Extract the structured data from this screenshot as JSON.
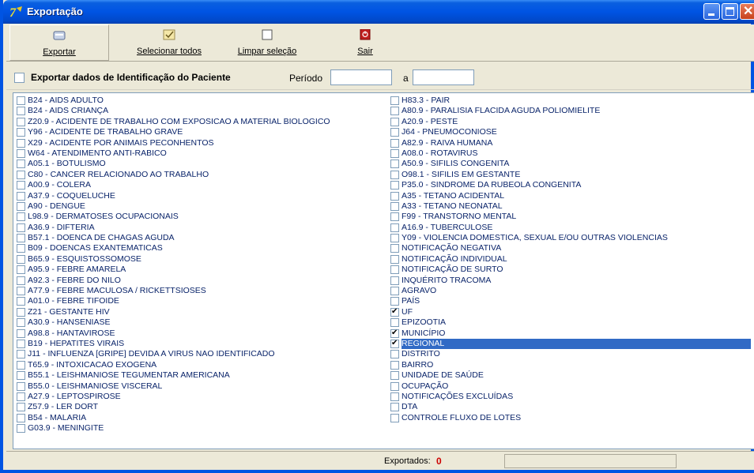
{
  "window": {
    "title": "Exportação"
  },
  "toolbar": {
    "export_label": "Exportar",
    "selectall_label": "Selecionar todos",
    "clear_label": "Limpar seleção",
    "exit_label": "Sair"
  },
  "options": {
    "export_id_label": "Exportar dados de Identificação do Paciente",
    "export_id_checked": false,
    "period_label": "Período",
    "period_from": "",
    "period_sep": "a",
    "period_to": ""
  },
  "list": {
    "left": [
      {
        "label": "B24 - AIDS ADULTO",
        "checked": false
      },
      {
        "label": "B24 - AIDS CRIANÇA",
        "checked": false
      },
      {
        "label": "Z20.9 - ACIDENTE DE TRABALHO COM EXPOSICAO A MATERIAL BIOLOGICO",
        "checked": false
      },
      {
        "label": "Y96 - ACIDENTE DE TRABALHO GRAVE",
        "checked": false
      },
      {
        "label": "X29 - ACIDENTE POR ANIMAIS PECONHENTOS",
        "checked": false
      },
      {
        "label": "W64 - ATENDIMENTO ANTI-RABICO",
        "checked": false
      },
      {
        "label": "A05.1 - BOTULISMO",
        "checked": false
      },
      {
        "label": "C80 - CANCER RELACIONADO AO TRABALHO",
        "checked": false
      },
      {
        "label": "A00.9 - COLERA",
        "checked": false
      },
      {
        "label": "A37.9 - COQUELUCHE",
        "checked": false
      },
      {
        "label": "A90 - DENGUE",
        "checked": false
      },
      {
        "label": "L98.9 - DERMATOSES OCUPACIONAIS",
        "checked": false
      },
      {
        "label": "A36.9 - DIFTERIA",
        "checked": false
      },
      {
        "label": "B57.1 - DOENCA DE CHAGAS AGUDA",
        "checked": false
      },
      {
        "label": "B09 - DOENCAS EXANTEMATICAS",
        "checked": false
      },
      {
        "label": "B65.9 - ESQUISTOSSOMOSE",
        "checked": false
      },
      {
        "label": "A95.9 - FEBRE AMARELA",
        "checked": false
      },
      {
        "label": "A92.3 - FEBRE DO NILO",
        "checked": false
      },
      {
        "label": "A77.9 - FEBRE MACULOSA / RICKETTSIOSES",
        "checked": false
      },
      {
        "label": "A01.0 - FEBRE TIFOIDE",
        "checked": false
      },
      {
        "label": "Z21 - GESTANTE HIV",
        "checked": false
      },
      {
        "label": "A30.9 - HANSENIASE",
        "checked": false
      },
      {
        "label": "A98.8 - HANTAVIROSE",
        "checked": false
      },
      {
        "label": "B19 - HEPATITES VIRAIS",
        "checked": false
      },
      {
        "label": "J11 - INFLUENZA [GRIPE] DEVIDA A VIRUS NAO IDENTIFICADO",
        "checked": false
      },
      {
        "label": "T65.9 - INTOXICACAO EXOGENA",
        "checked": false
      },
      {
        "label": "B55.1 - LEISHMANIOSE TEGUMENTAR AMERICANA",
        "checked": false
      },
      {
        "label": "B55.0 - LEISHMANIOSE VISCERAL",
        "checked": false
      },
      {
        "label": "A27.9 - LEPTOSPIROSE",
        "checked": false
      },
      {
        "label": "Z57.9 - LER DORT",
        "checked": false
      },
      {
        "label": "B54 - MALARIA",
        "checked": false
      },
      {
        "label": "G03.9 - MENINGITE",
        "checked": false
      }
    ],
    "right": [
      {
        "label": "H83.3 - PAIR",
        "checked": false
      },
      {
        "label": "A80.9 - PARALISIA FLACIDA AGUDA  POLIOMIELITE",
        "checked": false
      },
      {
        "label": "A20.9 - PESTE",
        "checked": false
      },
      {
        "label": "J64 - PNEUMOCONIOSE",
        "checked": false
      },
      {
        "label": "A82.9 - RAIVA HUMANA",
        "checked": false
      },
      {
        "label": "A08.0 - ROTAVIRUS",
        "checked": false
      },
      {
        "label": "A50.9 - SIFILIS CONGENITA",
        "checked": false
      },
      {
        "label": "O98.1 - SIFILIS EM GESTANTE",
        "checked": false
      },
      {
        "label": "P35.0 - SINDROME DA RUBEOLA CONGENITA",
        "checked": false
      },
      {
        "label": "A35 - TETANO ACIDENTAL",
        "checked": false
      },
      {
        "label": "A33 - TETANO NEONATAL",
        "checked": false
      },
      {
        "label": "F99 - TRANSTORNO MENTAL",
        "checked": false
      },
      {
        "label": "A16.9 - TUBERCULOSE",
        "checked": false
      },
      {
        "label": "Y09 - VIOLENCIA DOMESTICA, SEXUAL E/OU OUTRAS VIOLENCIAS",
        "checked": false
      },
      {
        "label": "NOTIFICAÇÃO NEGATIVA",
        "checked": false
      },
      {
        "label": "NOTIFICAÇÃO INDIVIDUAL",
        "checked": false
      },
      {
        "label": "NOTIFICAÇÃO DE SURTO",
        "checked": false
      },
      {
        "label": "INQUÉRITO TRACOMA",
        "checked": false
      },
      {
        "label": "AGRAVO",
        "checked": false
      },
      {
        "label": "PAÍS",
        "checked": false
      },
      {
        "label": "UF",
        "checked": true
      },
      {
        "label": "EPIZOOTIA",
        "checked": false
      },
      {
        "label": "MUNICÍPIO",
        "checked": true
      },
      {
        "label": "REGIONAL",
        "checked": true,
        "selected": true
      },
      {
        "label": "DISTRITO",
        "checked": false
      },
      {
        "label": "BAIRRO",
        "checked": false
      },
      {
        "label": "UNIDADE DE SAÚDE",
        "checked": false
      },
      {
        "label": "OCUPAÇÃO",
        "checked": false
      },
      {
        "label": "NOTIFICAÇÕES EXCLUÍDAS",
        "checked": false
      },
      {
        "label": "DTA",
        "checked": false
      },
      {
        "label": "CONTROLE FLUXO DE LOTES",
        "checked": false
      }
    ]
  },
  "status": {
    "exported_label": "Exportados:",
    "exported_count": "0"
  },
  "colors": {
    "titlebar": "#0054e3",
    "selection": "#316ac5",
    "list_text": "#0a246a",
    "count": "#cc0000",
    "face": "#ece9d8"
  },
  "icons": {
    "app": "app-logo-icon",
    "export": "export-icon",
    "selectall": "select-all-icon",
    "clear": "clear-selection-icon",
    "exit": "exit-icon"
  }
}
